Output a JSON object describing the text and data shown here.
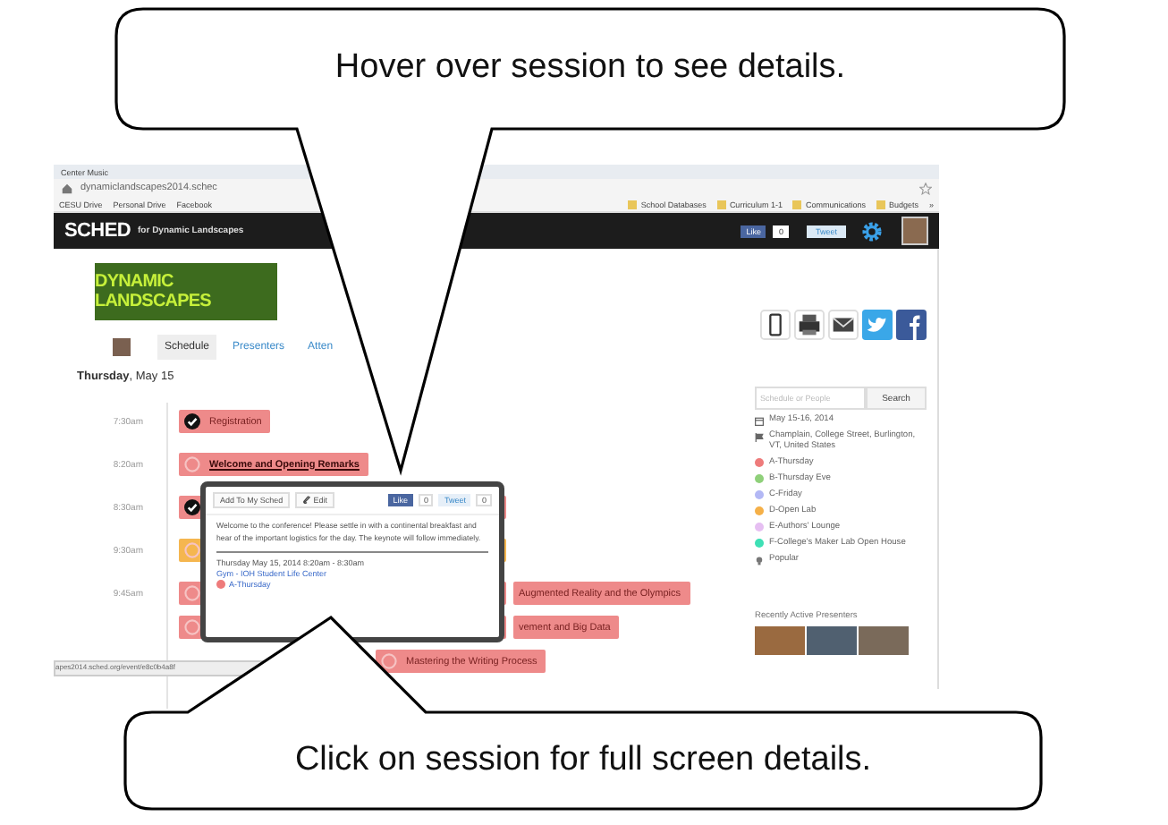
{
  "callouts": [
    {
      "text": "Hover over session to see details."
    },
    {
      "text": "Click on session for full screen details."
    }
  ],
  "browser": {
    "tab": "Center Music",
    "url": "dynamiclandscapes2014.schec",
    "bookmarks_left": [
      "CESU Drive",
      "Personal Drive",
      "Facebook"
    ],
    "bookmarks_right": [
      "School Databases",
      "Curriculum 1-1",
      "Communications",
      "Budgets"
    ],
    "more": "»"
  },
  "header": {
    "logo": "SCHED",
    "event": "for Dynamic Landscapes",
    "like": "Like",
    "like_count": "0",
    "tweet": "Tweet"
  },
  "site_logo": "DYNAMIC LANDSCAPES",
  "tabs": [
    {
      "label": "Schedule",
      "selected": true
    },
    {
      "label": "Presenters",
      "selected": false
    },
    {
      "label": "Atten",
      "selected": false
    }
  ],
  "day": "**Thursday**, May 15",
  "schedule": [
    {
      "time": "7:30am",
      "lines": [
        [
          {
            "title": "Registration",
            "checked": true,
            "color": "#ee8a8a"
          }
        ]
      ]
    },
    {
      "time": "8:20am",
      "lines": [
        [
          {
            "title": "Welcome and Opening Remarks",
            "checked": false,
            "hovered": true,
            "color": "#ee8a8a"
          }
        ]
      ]
    },
    {
      "time": "8:30am",
      "lines": [
        [
          {
            "checked": true,
            "color": "#ee8a8a"
          }
        ]
      ]
    },
    {
      "time": "9:30am",
      "lines": [
        [
          {
            "checked": false,
            "color": "#f5b64f"
          }
        ]
      ]
    },
    {
      "time": "9:45am",
      "lines": [
        [
          {
            "checked": false,
            "color": "#ee8a8a"
          },
          {
            "title": "Augmented Reality and the Olympics",
            "color": "#ee8a8a"
          }
        ],
        [
          {
            "checked": false,
            "color": "#ee8a8a"
          },
          {
            "title": "vement and Big Data",
            "color": "#ee8a8a"
          }
        ],
        [
          {
            "title": "Mastering the Writing Process",
            "checked": false,
            "color": "#ee8a8a"
          }
        ]
      ]
    }
  ],
  "popup": {
    "add": "Add To My Sched",
    "edit": "Edit",
    "like": "Like",
    "like_count": "0",
    "tweet": "Tweet",
    "tweet_count": "0",
    "description": "Welcome to the conference! Please settle in with a continental breakfast and hear of the important logistics for the day. The keynote will follow immediately.",
    "when": "Thursday May 15, 2014 8:20am - 8:30am",
    "venue": "Gym - IOH Student Life Center",
    "track": {
      "label": "A-Thursday",
      "color": "#ee7b7b"
    }
  },
  "status_url": "apes2014.sched.org/event/e8c0b4a8f",
  "sidebar": {
    "search": {
      "placeholder": "Schedule or People",
      "button": "Search"
    },
    "date": "May 15-16, 2014",
    "location": "Champlain, College Street, Burlington, VT, United States",
    "tracks": [
      {
        "label": "A-Thursday",
        "color": "#ee7b7b"
      },
      {
        "label": "B-Thursday Eve",
        "color": "#8fd07a"
      },
      {
        "label": "C-Friday",
        "color": "#b3b8f5"
      },
      {
        "label": "D-Open Lab",
        "color": "#f5b048"
      },
      {
        "label": "E-Authors' Lounge",
        "color": "#e6bff2"
      },
      {
        "label": "F-College's Maker Lab Open House",
        "color": "#3ee0b5"
      }
    ],
    "popular": "Popular",
    "presenters_title": "Recently Active Presenters"
  }
}
